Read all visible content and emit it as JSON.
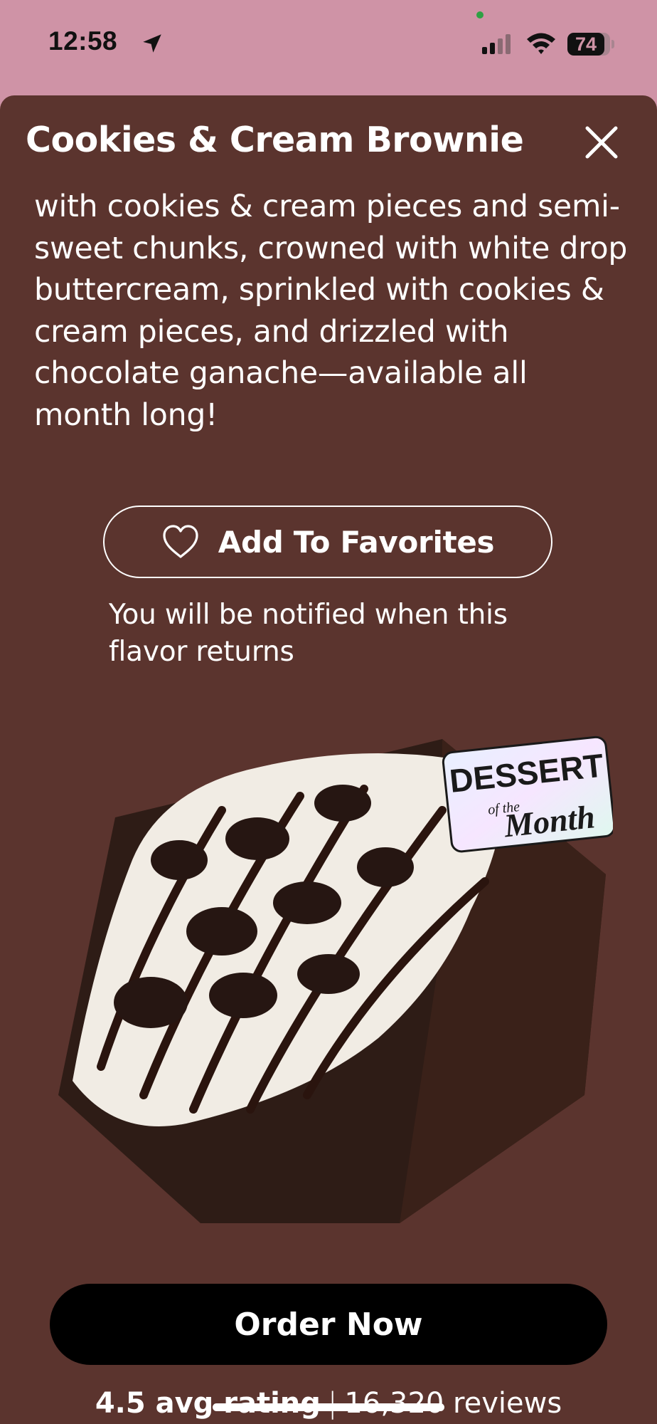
{
  "status_bar": {
    "time": "12:58",
    "battery_level": "74",
    "icons": [
      "location-arrow-icon",
      "cellular-signal-icon",
      "wifi-icon",
      "battery-icon"
    ]
  },
  "sheet": {
    "title": "Cookies & Cream Brownie",
    "close_icon": "close-icon",
    "description": "with cookies & cream pieces and semi-sweet chunks, crowned with white drop buttercream, sprinkled with cookies & cream pieces, and drizzled with chocolate ganache—available all month long!",
    "favorite_button": {
      "icon": "heart-outline-icon",
      "label": "Add To Favorites"
    },
    "notify_text": "You will be notified when this flavor returns",
    "product_image": {
      "badge_line1": "DESSERT",
      "badge_line2": "of the",
      "badge_line3": "Month"
    },
    "order_button_label": "Order Now",
    "rating": {
      "value": "4.5 avg rating",
      "separator": "|",
      "reviews": "16,320 reviews"
    }
  },
  "colors": {
    "status_bar_bg": "#cf93a6",
    "sheet_bg": "#5b342e",
    "order_button_bg": "#000000",
    "text": "#ffffff"
  }
}
